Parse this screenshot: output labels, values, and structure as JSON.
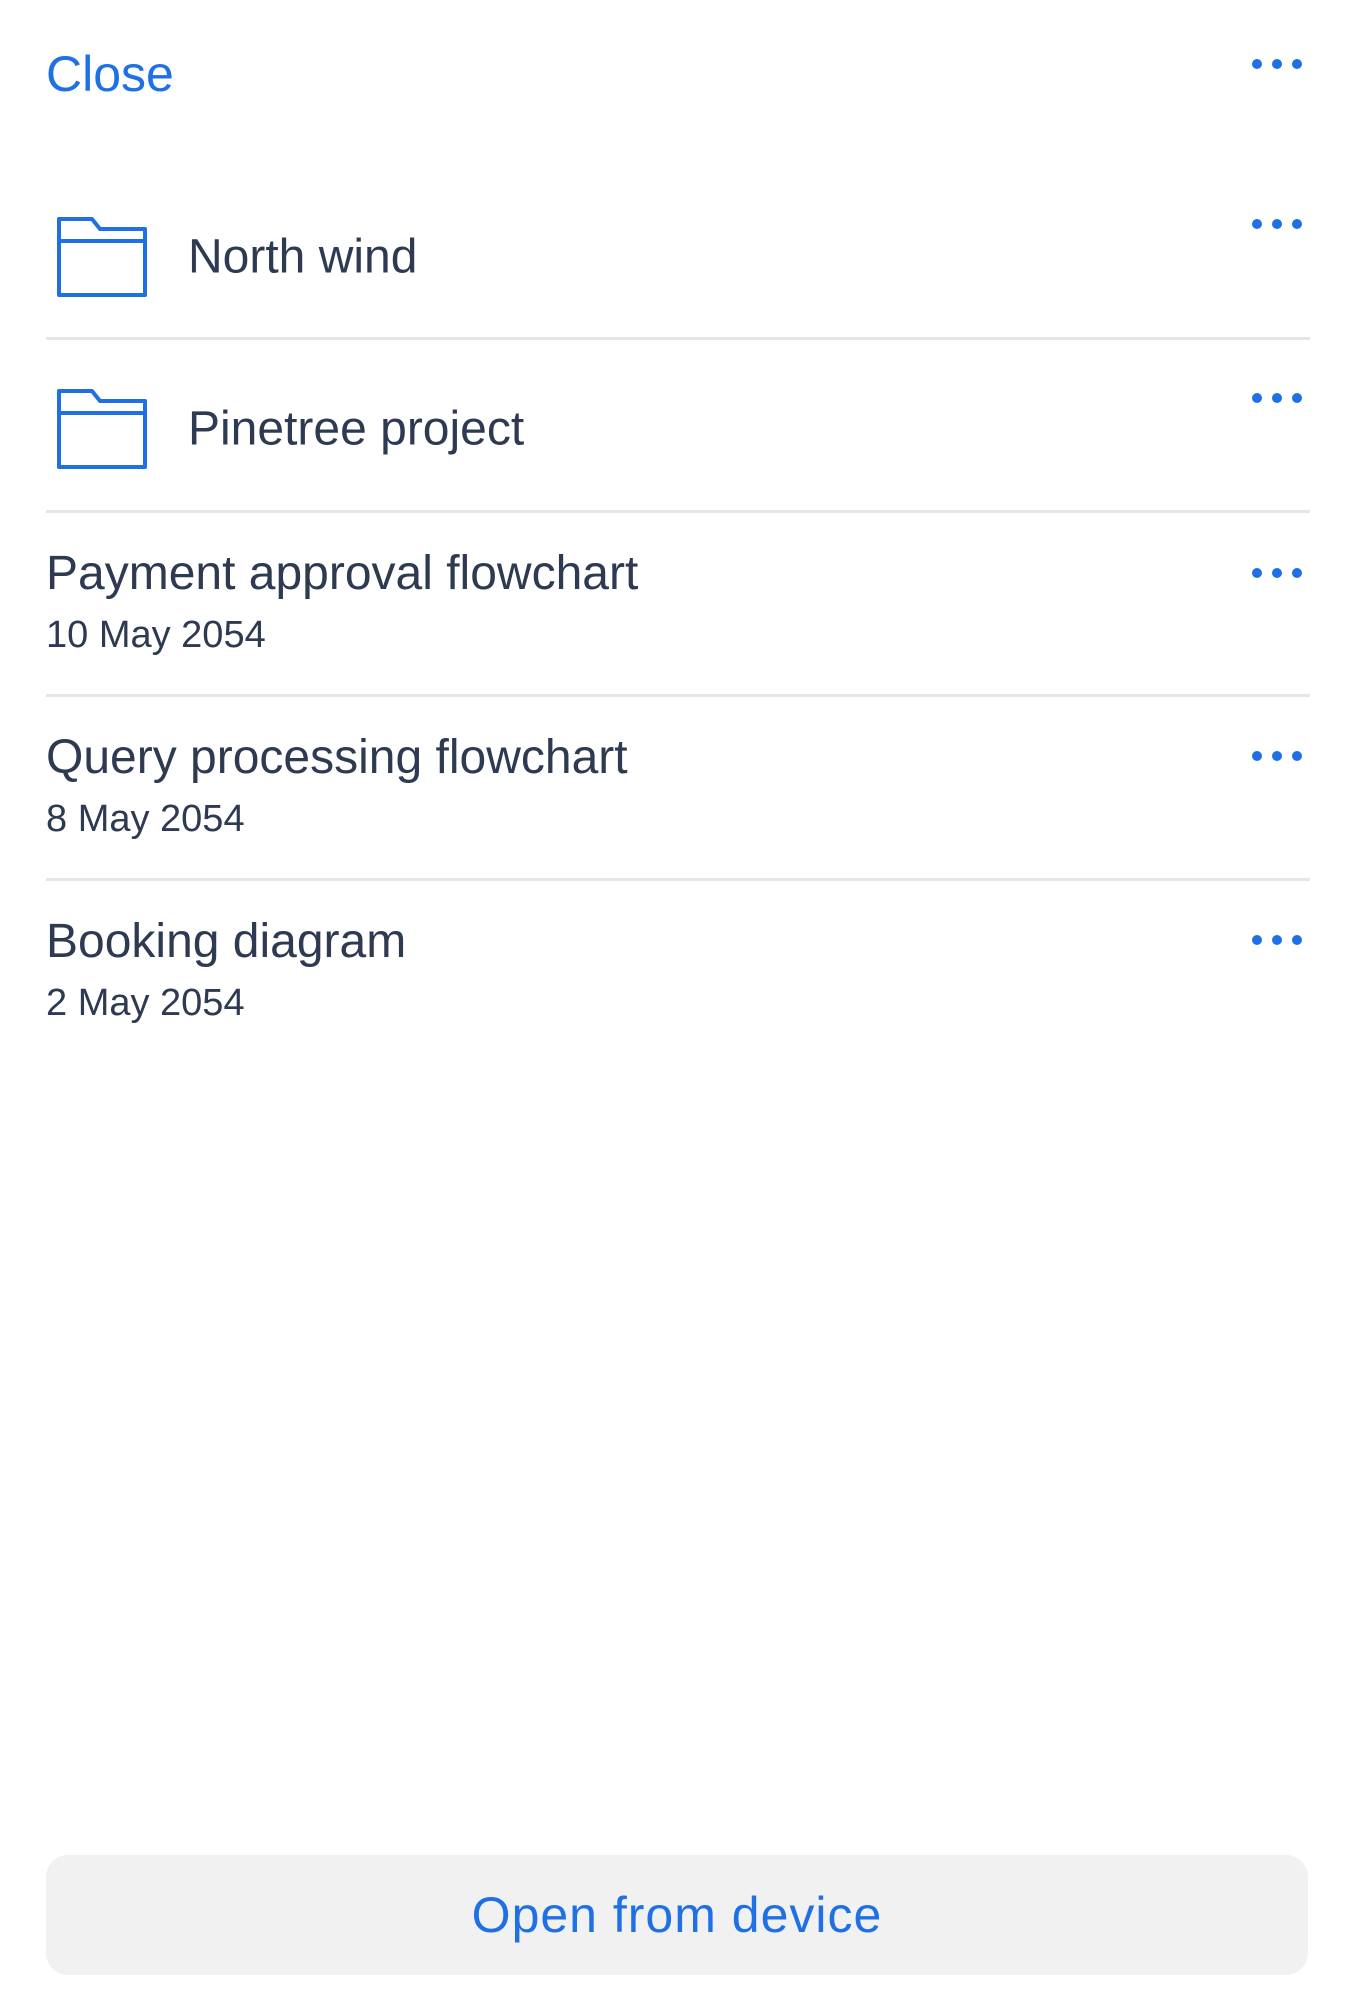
{
  "header": {
    "close_label": "Close",
    "more_icon": "more-horizontal-icon"
  },
  "folders": [
    {
      "name": "North wind",
      "icon": "folder-icon"
    },
    {
      "name": "Pinetree project",
      "icon": "folder-icon"
    }
  ],
  "files": [
    {
      "name": "Payment approval flowchart",
      "date": "10 May 2054"
    },
    {
      "name": "Query processing flowchart",
      "date": "8 May 2054"
    },
    {
      "name": "Booking diagram",
      "date": "2 May 2054"
    }
  ],
  "footer": {
    "open_from_device_label": "Open from device"
  },
  "colors": {
    "accent": "#1f6fe5",
    "text": "#2e3a52",
    "divider": "#e4e6ea",
    "button_bg": "#f1f1f2"
  }
}
